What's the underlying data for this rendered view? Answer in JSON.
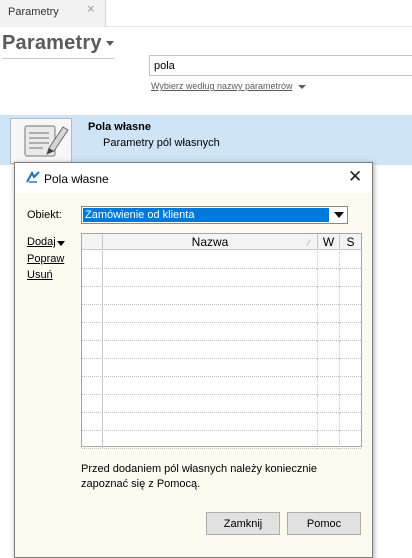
{
  "tabs": [
    {
      "label": "Parametry",
      "close_glyph": "×"
    }
  ],
  "header": {
    "title": "Parametry"
  },
  "search": {
    "value": "pola",
    "placeholder": "",
    "filter_label": "Wybierz według nazwy parametrów"
  },
  "results": [
    {
      "title": "Pola własne",
      "description": "Parametry pól własnych",
      "icon": "notepad-pencil-icon"
    }
  ],
  "dialog": {
    "title": "Pola własne",
    "close_glyph": "✕",
    "obiekt_label": "Obiekt:",
    "obiekt_value": "Zamówienie od klienta",
    "actions": {
      "add": "Dodaj",
      "edit": "Popraw",
      "delete": "Usuń"
    },
    "grid": {
      "columns": [
        "",
        "Nazwa",
        "W",
        "S"
      ],
      "sort_glyph": "⁄",
      "rows": []
    },
    "info": "Przed dodaniem pól własnych należy koniecznie zapoznać się z Pomocą.",
    "buttons": {
      "close": "Zamknij",
      "help": "Pomoc"
    }
  },
  "colors": {
    "selection": "#0078d7",
    "result_highlight": "#cfe5f7",
    "dialog_bg": "#fdfaf0"
  }
}
